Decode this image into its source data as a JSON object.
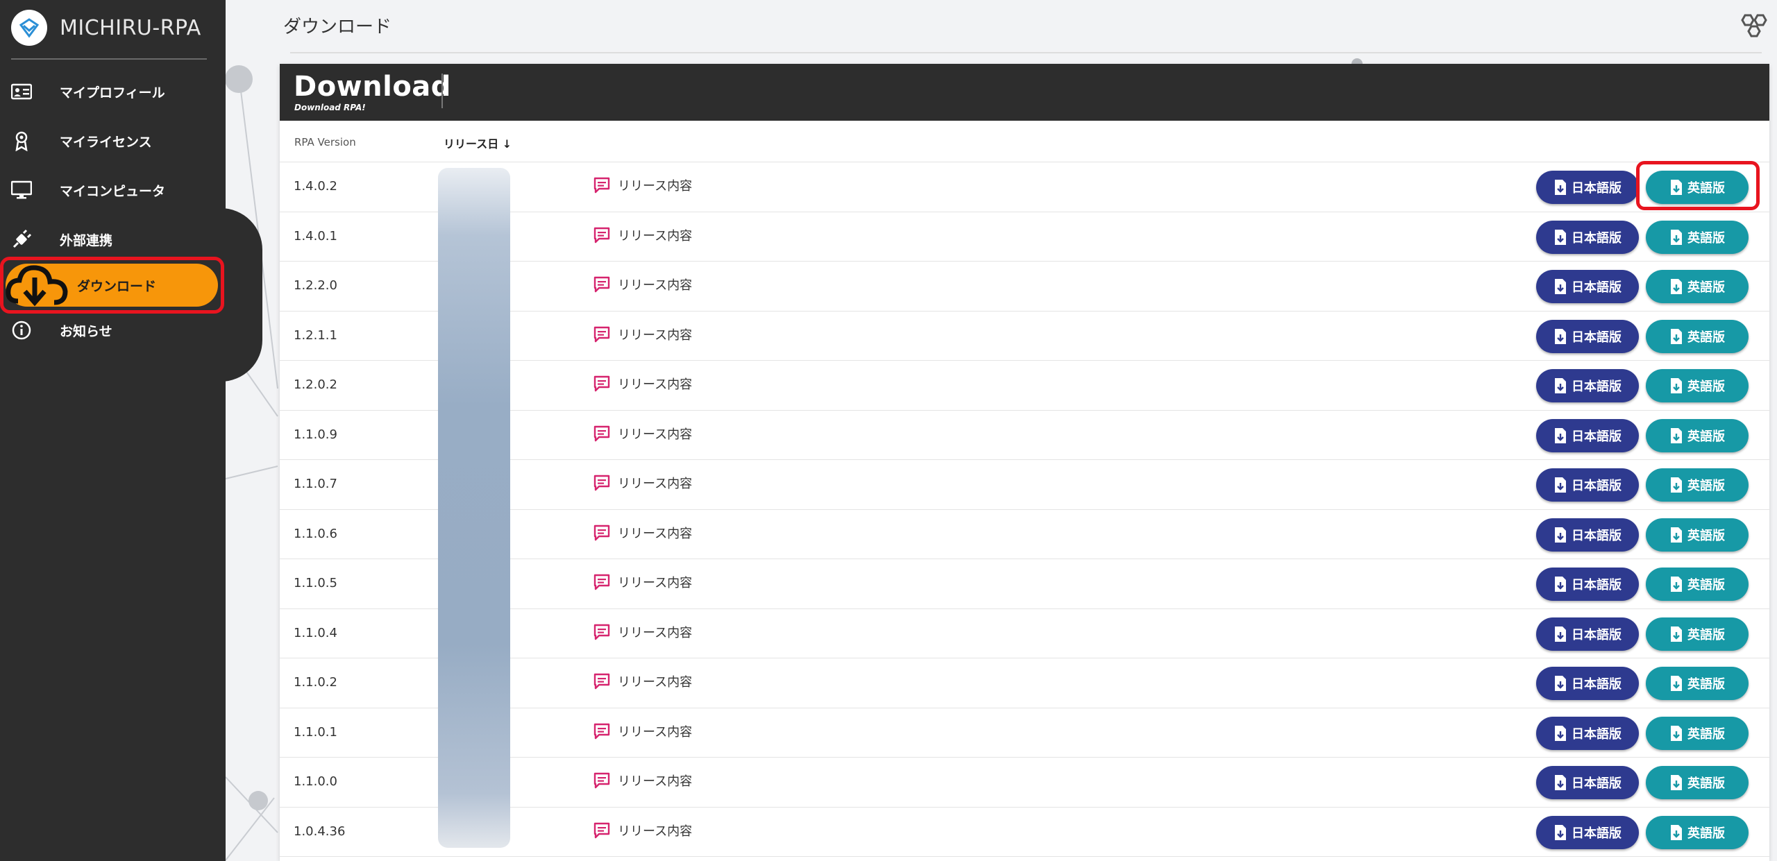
{
  "brand": {
    "name": "MICHIRU-RPA"
  },
  "sidebar": {
    "items": [
      {
        "label": "マイプロフィール",
        "icon": "profile-card-icon"
      },
      {
        "label": "マイライセンス",
        "icon": "license-badge-icon"
      },
      {
        "label": "マイコンピュータ",
        "icon": "monitor-icon"
      },
      {
        "label": "外部連携",
        "icon": "plug-icon"
      },
      {
        "label": "ダウンロード",
        "icon": "cloud-download-icon",
        "active": true
      },
      {
        "label": "お知らせ",
        "icon": "info-icon"
      }
    ]
  },
  "header": {
    "title": "ダウンロード"
  },
  "card": {
    "title": "Download",
    "subtitle": "Download RPA!"
  },
  "table": {
    "columns": {
      "version": "RPA Version",
      "date": "リリース日"
    },
    "notes_label": "リリース内容",
    "ja_label": "日本語版",
    "en_label": "英語版",
    "rows": [
      {
        "version": "1.4.0.2"
      },
      {
        "version": "1.4.0.1"
      },
      {
        "version": "1.2.2.0"
      },
      {
        "version": "1.2.1.1"
      },
      {
        "version": "1.2.0.2"
      },
      {
        "version": "1.1.0.9"
      },
      {
        "version": "1.1.0.7"
      },
      {
        "version": "1.1.0.6"
      },
      {
        "version": "1.1.0.5"
      },
      {
        "version": "1.1.0.4"
      },
      {
        "version": "1.1.0.2"
      },
      {
        "version": "1.1.0.1"
      },
      {
        "version": "1.1.0.0"
      },
      {
        "version": "1.0.4.36"
      }
    ]
  },
  "colors": {
    "sidebar_bg": "#2d2d2d",
    "active_nav": "#f7960a",
    "ja_button": "#2e3a8f",
    "en_button": "#1799a6",
    "highlight": "#e8141f",
    "note_icon": "#d6246e"
  }
}
